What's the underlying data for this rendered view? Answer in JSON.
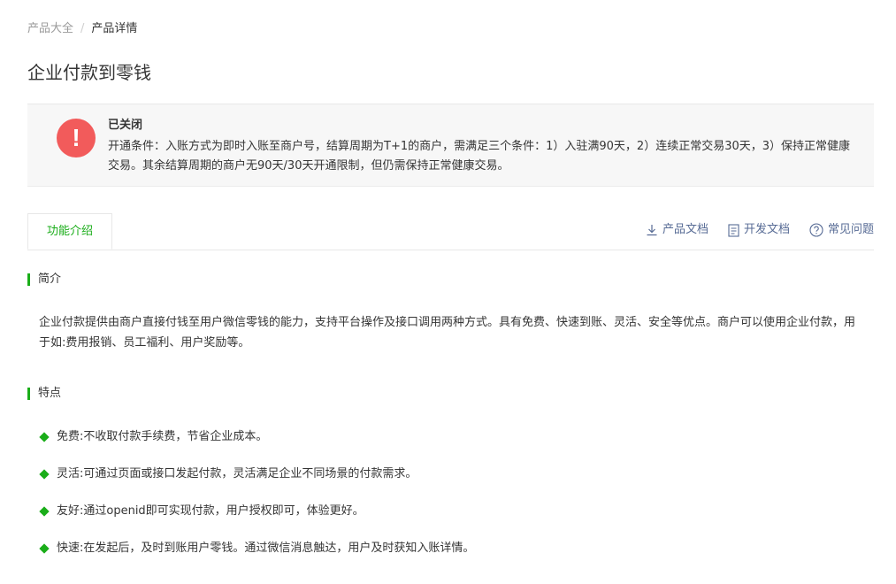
{
  "breadcrumb": {
    "parent": "产品大全",
    "separator": "/",
    "current": "产品详情"
  },
  "page_title": "企业付款到零钱",
  "notice": {
    "icon": "exclamation-icon",
    "title": "已关闭",
    "body": "开通条件：入账方式为即时入账至商户号，结算周期为T+1的商户，需满足三个条件：1）入驻满90天，2）连续正常交易30天，3）保持正常健康交易。其余结算周期的商户无90天/30天开通限制，但仍需保持正常健康交易。"
  },
  "tabs": {
    "active": "功能介绍"
  },
  "links": {
    "product_doc": "产品文档",
    "dev_doc": "开发文档",
    "faq": "常见问题"
  },
  "sections": {
    "intro": {
      "title": "简介",
      "text": "企业付款提供由商户直接付钱至用户微信零钱的能力，支持平台操作及接口调用两种方式。具有免费、快速到账、灵活、安全等优点。商户可以使用企业付款，用于如:费用报销、员工福利、用户奖励等。"
    },
    "features": {
      "title": "特点",
      "items": [
        "免费:不收取付款手续费，节省企业成本。",
        "灵活:可通过页面或接口发起付款，灵活满足企业不同场景的付款需求。",
        "友好:通过openid即可实现付款，用户授权即可，体验更好。",
        "快速:在发起后，及时到账用户零钱。通过微信消息触达，用户及时获知入账详情。"
      ]
    }
  },
  "colors": {
    "accent": "#1aad19",
    "link": "#576b95",
    "alert": "#f25b5b"
  }
}
